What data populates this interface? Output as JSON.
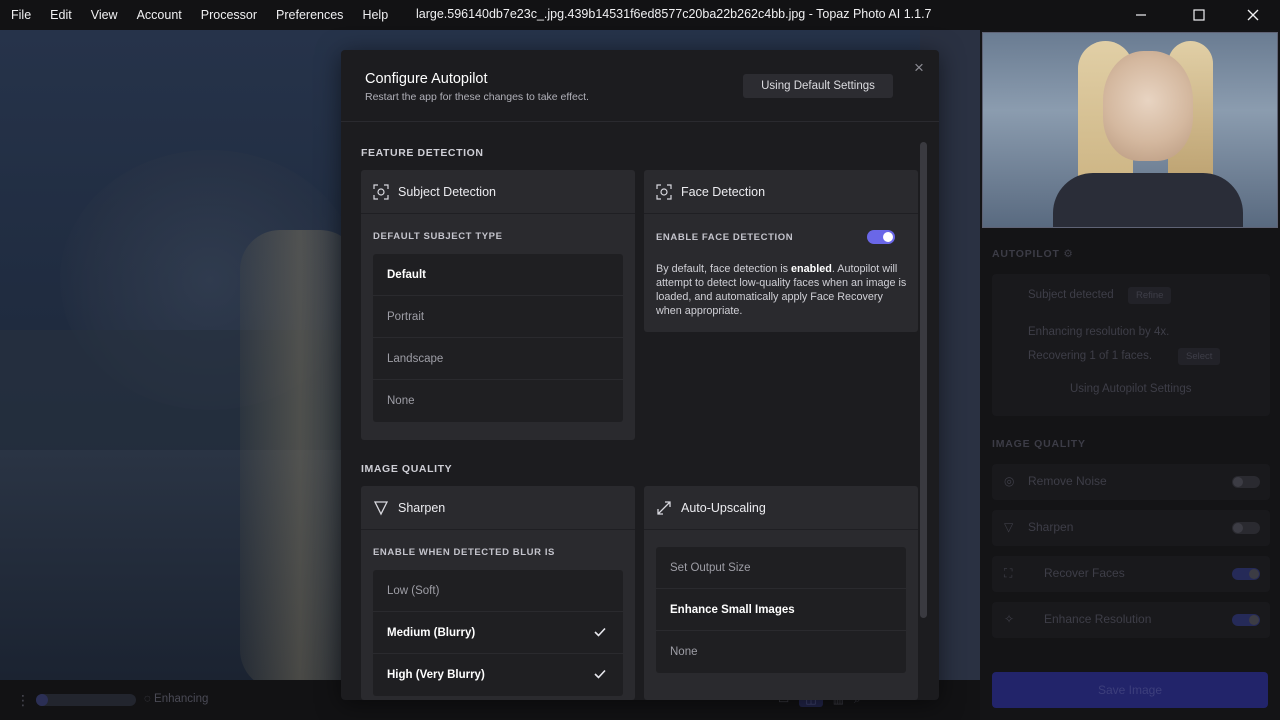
{
  "menu": [
    "File",
    "Edit",
    "View",
    "Account",
    "Processor",
    "Preferences",
    "Help"
  ],
  "window_title": "large.596140db7e23c_.jpg.439b14531f6ed8577c20ba22b262c4bb.jpg - Topaz Photo AI 1.1.7",
  "window_controls": {
    "minimize": "—",
    "maximize": "☐",
    "close": "✕"
  },
  "bottom": {
    "status": "Enhancing",
    "progress": 0.12
  },
  "right_panel": {
    "autopilot_title": "AUTOPILOT",
    "subject_detected": "Subject detected",
    "refine": "Refine",
    "enhancing": "Enhancing resolution by 4x.",
    "recovering": "Recovering 1 of 1 faces.",
    "select": "Select",
    "using_autopilot": "Using Autopilot Settings",
    "image_quality_title": "IMAGE QUALITY",
    "rows": [
      {
        "label": "Remove Noise",
        "on": false
      },
      {
        "label": "Sharpen",
        "on": false
      },
      {
        "label": "Recover Faces",
        "on": true
      },
      {
        "label": "Enhance Resolution",
        "on": true
      }
    ],
    "save": "Save Image"
  },
  "modal": {
    "title": "Configure Autopilot",
    "subtitle": "Restart the app for these changes to take effect.",
    "default_button": "Using Default Settings",
    "close": "×",
    "feature_detection": "FEATURE DETECTION",
    "subject": {
      "title": "Subject Detection",
      "label": "DEFAULT SUBJECT TYPE",
      "options": [
        "Default",
        "Portrait",
        "Landscape",
        "None"
      ],
      "selected": 0
    },
    "face": {
      "title": "Face Detection",
      "label": "ENABLE FACE DETECTION",
      "enabled": true,
      "desc_pre": "By default, face detection is ",
      "desc_bold": "enabled",
      "desc_post": ". Autopilot will attempt to detect low-quality faces when an image is loaded, and automatically apply Face Recovery when appropriate."
    },
    "image_quality": "IMAGE QUALITY",
    "sharpen": {
      "title": "Sharpen",
      "label": "ENABLE WHEN DETECTED BLUR IS",
      "options": [
        "Low (Soft)",
        "Medium (Blurry)",
        "High (Very Blurry)"
      ],
      "checked": [
        false,
        true,
        true
      ]
    },
    "upscale": {
      "title": "Auto-Upscaling",
      "options": [
        "Set Output Size",
        "Enhance Small Images",
        "None"
      ],
      "selected": 1
    }
  }
}
